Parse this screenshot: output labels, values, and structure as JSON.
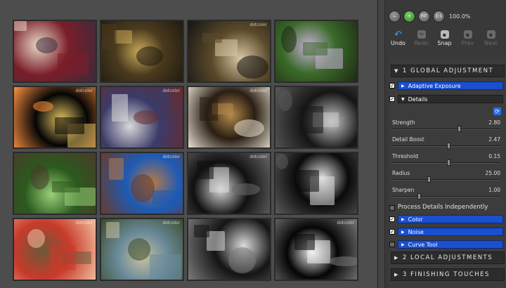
{
  "toolbar": {
    "zoom_level": "100.0%",
    "zoom_buttons": [
      {
        "icon": "zoom-out-icon",
        "glyph": "−"
      },
      {
        "icon": "zoom-in-icon",
        "glyph": "+"
      },
      {
        "icon": "fit-icon",
        "glyph": "FIT"
      },
      {
        "icon": "one-to-one-icon",
        "glyph": "1:1"
      }
    ]
  },
  "history": [
    {
      "label": "Undo",
      "enabled": true
    },
    {
      "label": "Redo",
      "enabled": false
    },
    {
      "label": "Snap",
      "enabled": true
    },
    {
      "label": "Prev",
      "enabled": false
    },
    {
      "label": "Next",
      "enabled": false
    }
  ],
  "adjustments": {
    "global_title": "1 GLOBAL ADJUSTMENT",
    "adaptive_exposure": "Adaptive Exposure",
    "details": "Details",
    "sliders": [
      {
        "name": "Strength",
        "value": "2.80",
        "fraction": 0.62
      },
      {
        "name": "Detail Boost",
        "value": "2.47",
        "fraction": 0.52
      },
      {
        "name": "Threshold",
        "value": "0.15",
        "fraction": 0.52
      },
      {
        "name": "Radius",
        "value": "25.00",
        "fraction": 0.33
      },
      {
        "name": "Sharpen",
        "value": "1.00",
        "fraction": 0.24
      }
    ],
    "process_independently": "Process Details Independently",
    "color": "Color",
    "noise": "Noise",
    "curve_tool": "Curve Tool",
    "local_title": "2 LOCAL ADJUSTMENTS",
    "finishing_title": "3 FINISHING TOUCHES"
  },
  "grid": {
    "watermark": "dotcolor",
    "thumbnails": [
      {
        "subject": "hanging-peppers",
        "colors": [
          "#7a1e2a",
          "#e9d9c6",
          "#3a2b3c"
        ]
      },
      {
        "subject": "pottery-bowls",
        "colors": [
          "#4a3b1e",
          "#c9a85a",
          "#1f1a10"
        ]
      },
      {
        "subject": "woman-portrait",
        "colors": [
          "#5a4a2a",
          "#d8c7a4",
          "#141414"
        ]
      },
      {
        "subject": "girl-in-foliage",
        "colors": [
          "#3a6a2a",
          "#c9b0d8",
          "#1e2a14"
        ]
      },
      {
        "subject": "night-cityscape",
        "colors": [
          "#050505",
          "#e0c060",
          "#ff9040"
        ]
      },
      {
        "subject": "striped-wall",
        "colors": [
          "#3b3b6a",
          "#d8d8d8",
          "#6a2b2b"
        ]
      },
      {
        "subject": "musician-cello",
        "colors": [
          "#2a1e14",
          "#b48a4a",
          "#e8e0d0"
        ]
      },
      {
        "subject": "gothic-building",
        "colors": [
          "#151515",
          "#c8c8c8",
          "#5a5a5a"
        ]
      },
      {
        "subject": "garden-urn",
        "colors": [
          "#2b5a1e",
          "#9ad07a",
          "#4a3b2a"
        ]
      },
      {
        "subject": "adobe-church",
        "colors": [
          "#1e5ab4",
          "#b47a4a",
          "#6a3b2a"
        ]
      },
      {
        "subject": "bw-face",
        "colors": [
          "#101010",
          "#d8d8d8",
          "#6a6a6a"
        ]
      },
      {
        "subject": "spiral-staircase",
        "colors": [
          "#0a0a0a",
          "#e0e0e0",
          "#5a5a5a"
        ]
      },
      {
        "subject": "red-sunset-field",
        "colors": [
          "#c83a2a",
          "#6a5a3a",
          "#f0c0a0"
        ]
      },
      {
        "subject": "rolling-hills",
        "colors": [
          "#6a8a9a",
          "#c8c0a0",
          "#3a4a2a"
        ]
      },
      {
        "subject": "bw-motorcycle",
        "colors": [
          "#141414",
          "#dcdcdc",
          "#7a7a7a"
        ]
      },
      {
        "subject": "bw-collage",
        "colors": [
          "#050505",
          "#f0f0f0",
          "#7a7a7a"
        ]
      }
    ]
  }
}
